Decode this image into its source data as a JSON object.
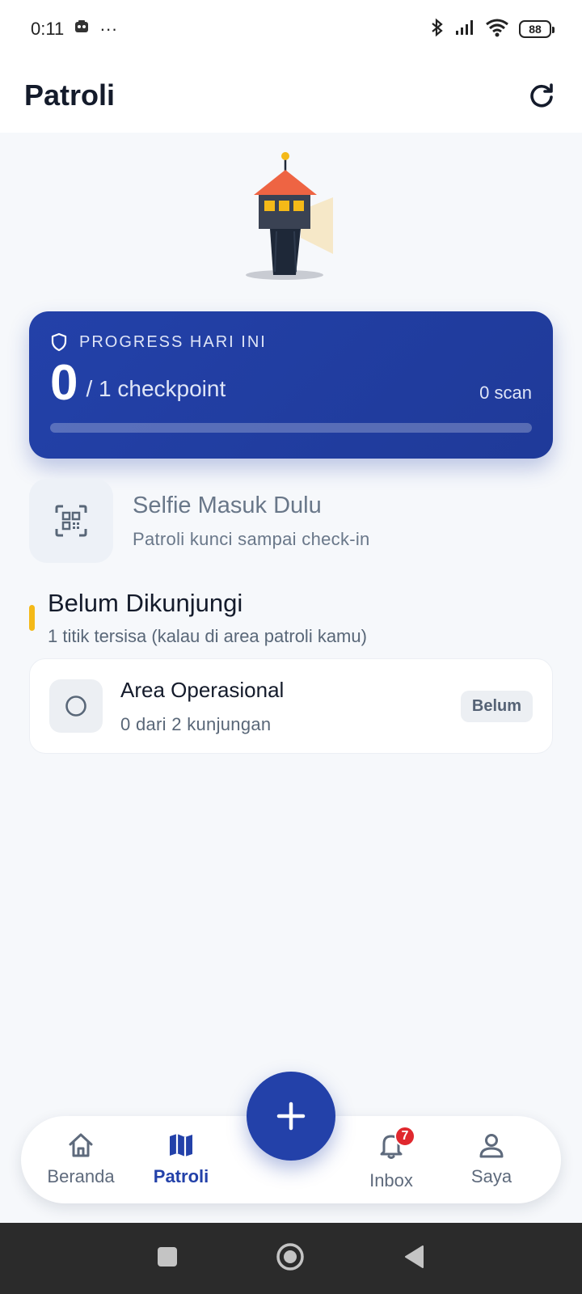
{
  "status_bar": {
    "time": "0:11",
    "more": "···",
    "battery": "88"
  },
  "header": {
    "title": "Patroli"
  },
  "progress": {
    "label": "PROGRESS HARI INI",
    "count": "0",
    "total_text": "/ 1 checkpoint",
    "scan_text": "0 scan",
    "fraction": 0.0
  },
  "selfie": {
    "title": "Selfie Masuk Dulu",
    "subtitle": "Patroli kunci sampai check-in"
  },
  "section": {
    "title": "Belum Dikunjungi",
    "subtitle": "1 titik tersisa (kalau di area patroli kamu)"
  },
  "areas": [
    {
      "title": "Area Operasional",
      "subtitle": "0 dari 2 kunjungan",
      "badge": "Belum"
    }
  ],
  "nav": {
    "items": [
      {
        "label": "Beranda",
        "icon": "home-icon"
      },
      {
        "label": "Patroli",
        "icon": "map-icon"
      },
      {
        "label": "Inbox",
        "icon": "bell-icon",
        "badge": "7"
      },
      {
        "label": "Saya",
        "icon": "user-icon"
      }
    ],
    "fab_icon": "plus-icon"
  },
  "colors": {
    "primary": "#2341a9",
    "accent": "#f4b918",
    "badge_red": "#e0282e"
  }
}
